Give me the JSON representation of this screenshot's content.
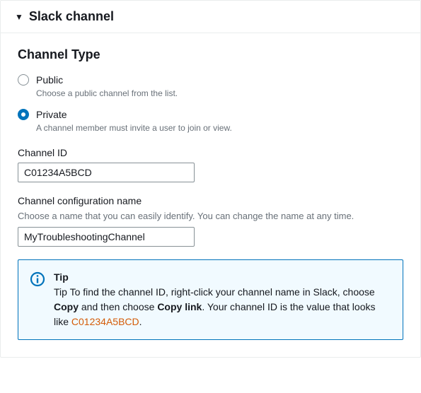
{
  "header": {
    "title": "Slack channel"
  },
  "channelType": {
    "heading": "Channel Type",
    "options": {
      "public": {
        "label": "Public",
        "desc": "Choose a public channel from the list."
      },
      "private": {
        "label": "Private",
        "desc": "A channel member must invite a user to join or view."
      }
    }
  },
  "channelId": {
    "label": "Channel ID",
    "value": "C01234A5BCD"
  },
  "configName": {
    "label": "Channel configuration name",
    "helper": "Choose a name that you can easily identify. You can change the name at any time.",
    "value": "MyTroubleshootingChannel"
  },
  "tip": {
    "title": "Tip",
    "text_prefix": "Tip To find the channel ID, right-click your channel name in Slack, choose ",
    "copy": "Copy",
    "mid1": " and then choose ",
    "copylink": "Copy link",
    "mid2": ". Your channel ID is the value that looks like ",
    "example": "C01234A5BCD",
    "suffix": "."
  }
}
